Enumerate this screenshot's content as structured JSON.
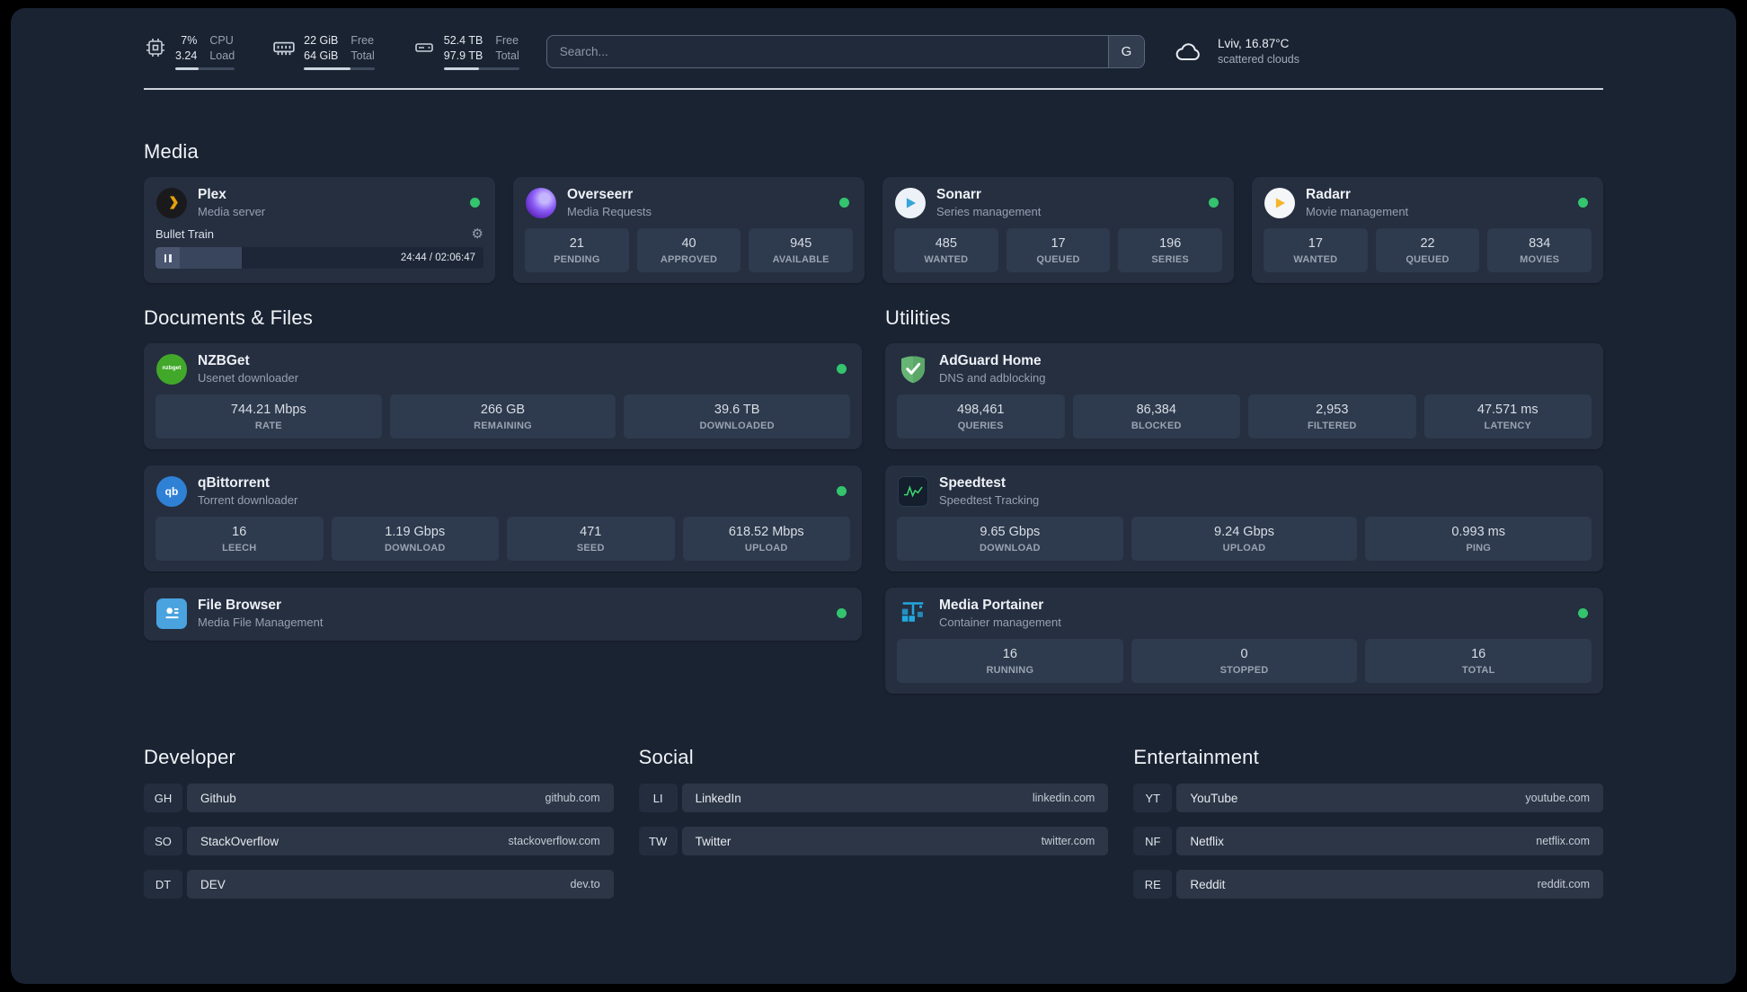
{
  "topbar": {
    "resources": [
      {
        "icon": "cpu-icon",
        "rows": [
          [
            "7%",
            "CPU"
          ],
          [
            "3.24",
            "Load"
          ]
        ],
        "meter": 40
      },
      {
        "icon": "memory-icon",
        "rows": [
          [
            "22 GiB",
            "Free"
          ],
          [
            "64 GiB",
            "Total"
          ]
        ],
        "meter": 66
      },
      {
        "icon": "disk-icon",
        "rows": [
          [
            "52.4 TB",
            "Free"
          ],
          [
            "97.9 TB",
            "Total"
          ]
        ],
        "meter": 47
      }
    ],
    "search": {
      "placeholder": "Search...",
      "provider": "G"
    },
    "weather": {
      "icon": "cloud-icon",
      "location": "Lviv, 16.87°C",
      "condition": "scattered clouds"
    }
  },
  "service_groups": [
    {
      "title": "Media",
      "services": [
        {
          "name": "Plex",
          "subtitle": "Media server",
          "icon": "plex-icon",
          "online": true,
          "player": {
            "track": "Bullet Train",
            "time": "24:44 / 02:06:47",
            "progress": 19
          }
        },
        {
          "name": "Overseerr",
          "subtitle": "Media Requests",
          "icon": "overseerr-icon",
          "online": true,
          "stats": [
            {
              "value": "21",
              "label": "PENDING"
            },
            {
              "value": "40",
              "label": "APPROVED"
            },
            {
              "value": "945",
              "label": "AVAILABLE"
            }
          ]
        },
        {
          "name": "Sonarr",
          "subtitle": "Series management",
          "icon": "sonarr-icon",
          "online": true,
          "stats": [
            {
              "value": "485",
              "label": "WANTED"
            },
            {
              "value": "17",
              "label": "QUEUED"
            },
            {
              "value": "196",
              "label": "SERIES"
            }
          ]
        },
        {
          "name": "Radarr",
          "subtitle": "Movie management",
          "icon": "radarr-icon",
          "online": true,
          "stats": [
            {
              "value": "17",
              "label": "WANTED"
            },
            {
              "value": "22",
              "label": "QUEUED"
            },
            {
              "value": "834",
              "label": "MOVIES"
            }
          ]
        }
      ]
    },
    {
      "title": "Documents & Files",
      "services": [
        {
          "name": "NZBGet",
          "subtitle": "Usenet downloader",
          "icon": "nzbget-icon",
          "online": true,
          "stats": [
            {
              "value": "744.21 Mbps",
              "label": "RATE"
            },
            {
              "value": "266 GB",
              "label": "REMAINING"
            },
            {
              "value": "39.6 TB",
              "label": "DOWNLOADED"
            }
          ]
        },
        {
          "name": "qBittorrent",
          "subtitle": "Torrent downloader",
          "icon": "qbittorrent-icon",
          "online": true,
          "stats": [
            {
              "value": "16",
              "label": "LEECH"
            },
            {
              "value": "1.19 Gbps",
              "label": "DOWNLOAD"
            },
            {
              "value": "471",
              "label": "SEED"
            },
            {
              "value": "618.52 Mbps",
              "label": "UPLOAD"
            }
          ]
        },
        {
          "name": "File Browser",
          "subtitle": "Media File Management",
          "icon": "filebrowser-icon",
          "online": true
        }
      ]
    },
    {
      "title": "Utilities",
      "services": [
        {
          "name": "AdGuard Home",
          "subtitle": "DNS and adblocking",
          "icon": "adguard-icon",
          "online": false,
          "stats": [
            {
              "value": "498,461",
              "label": "QUERIES"
            },
            {
              "value": "86,384",
              "label": "BLOCKED"
            },
            {
              "value": "2,953",
              "label": "FILTERED"
            },
            {
              "value": "47.571 ms",
              "label": "LATENCY"
            }
          ]
        },
        {
          "name": "Speedtest",
          "subtitle": "Speedtest Tracking",
          "icon": "speedtest-icon",
          "online": false,
          "stats": [
            {
              "value": "9.65 Gbps",
              "label": "DOWNLOAD"
            },
            {
              "value": "9.24 Gbps",
              "label": "UPLOAD"
            },
            {
              "value": "0.993 ms",
              "label": "PING"
            }
          ]
        },
        {
          "name": "Media Portainer",
          "subtitle": "Container management",
          "icon": "portainer-icon",
          "online": true,
          "stats": [
            {
              "value": "16",
              "label": "RUNNING"
            },
            {
              "value": "0",
              "label": "STOPPED"
            },
            {
              "value": "16",
              "label": "TOTAL"
            }
          ]
        }
      ]
    }
  ],
  "bookmark_groups": [
    {
      "title": "Developer",
      "bookmarks": [
        {
          "abbr": "GH",
          "name": "Github",
          "url": "github.com"
        },
        {
          "abbr": "SO",
          "name": "StackOverflow",
          "url": "stackoverflow.com"
        },
        {
          "abbr": "DT",
          "name": "DEV",
          "url": "dev.to"
        }
      ]
    },
    {
      "title": "Social",
      "bookmarks": [
        {
          "abbr": "LI",
          "name": "LinkedIn",
          "url": "linkedin.com"
        },
        {
          "abbr": "TW",
          "name": "Twitter",
          "url": "twitter.com"
        }
      ]
    },
    {
      "title": "Entertainment",
      "bookmarks": [
        {
          "abbr": "YT",
          "name": "YouTube",
          "url": "youtube.com"
        },
        {
          "abbr": "NF",
          "name": "Netflix",
          "url": "netflix.com"
        },
        {
          "abbr": "RE",
          "name": "Reddit",
          "url": "reddit.com"
        }
      ]
    }
  ]
}
